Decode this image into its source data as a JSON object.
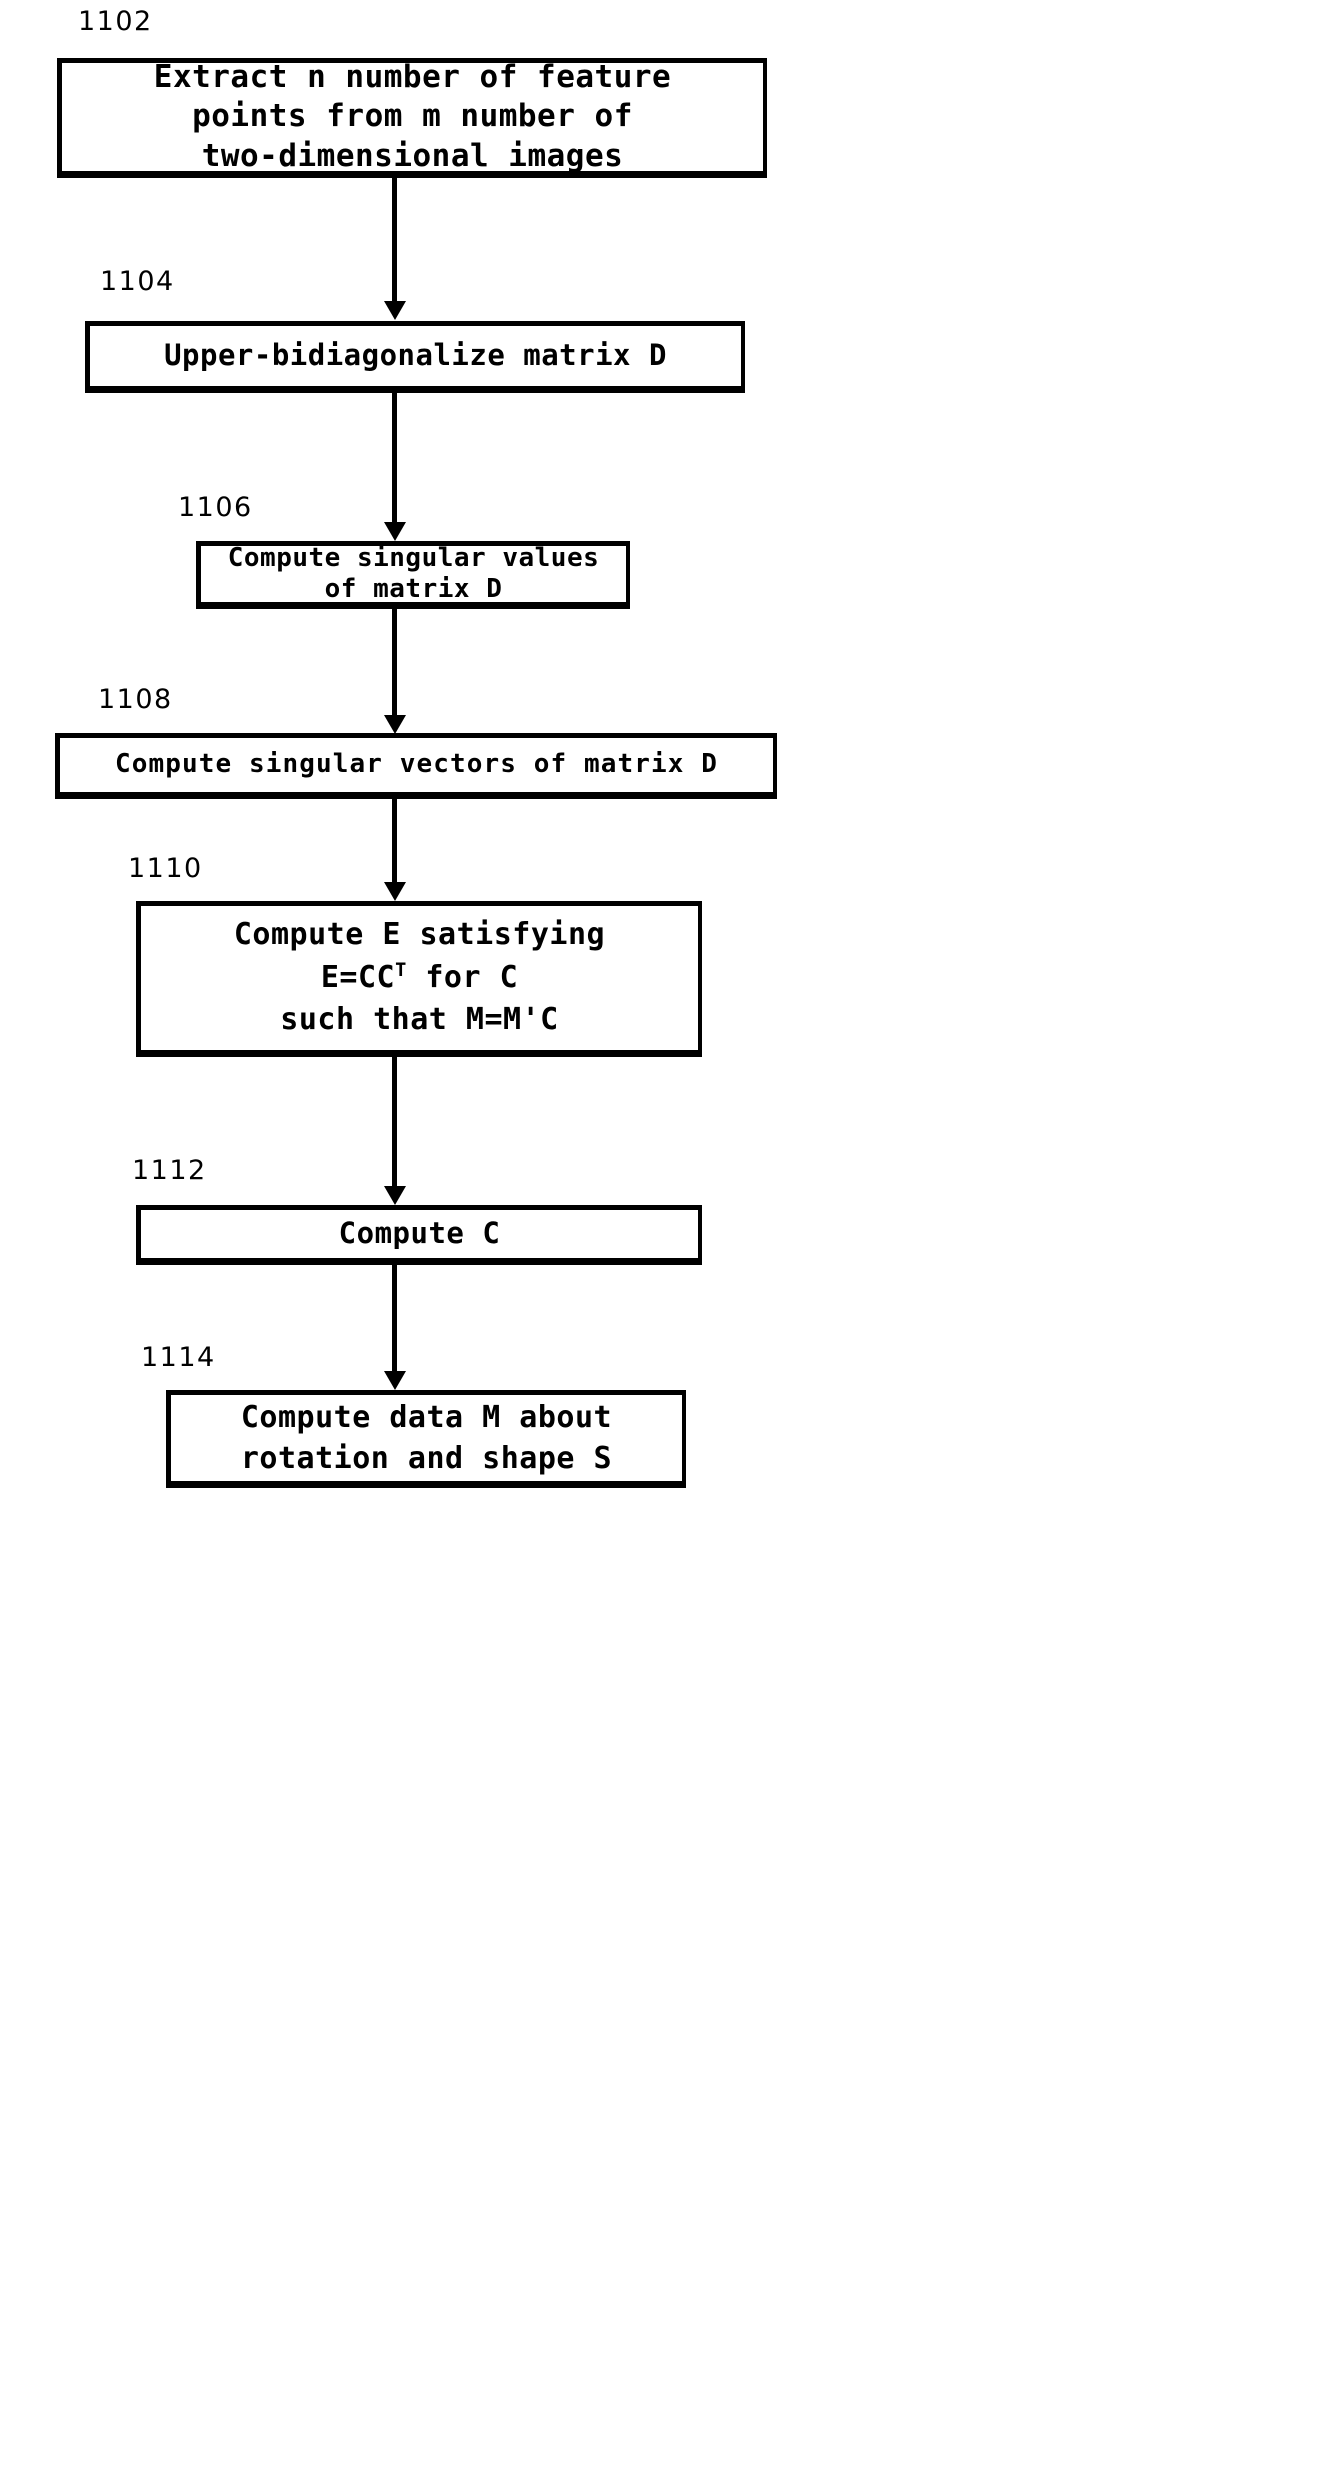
{
  "figure": {
    "type": "flowchart",
    "orientation": "vertical",
    "ink_color": "#000000",
    "background_color": "#ffffff"
  },
  "nodes": [
    {
      "ref": "1102",
      "text": "Extract n number of feature\npoints from m number of\ntwo-dimensional images"
    },
    {
      "ref": "1104",
      "text": "Upper-bidiagonalize matrix D"
    },
    {
      "ref": "1106",
      "text": "Compute singular values\nof matrix D"
    },
    {
      "ref": "1108",
      "text": "Compute singular vectors of matrix D"
    },
    {
      "ref": "1110",
      "text": "Compute E satisfying\nE=CCT for C\nsuch that M=M'C",
      "line1": "Compute E satisfying",
      "line2_base": "E=CC",
      "line2_sup": "T",
      "line2_tail": " for C",
      "line3": "such that M=M'C"
    },
    {
      "ref": "1112",
      "text": "Compute C"
    },
    {
      "ref": "1114",
      "text": "Compute data M about\nrotation and shape S"
    }
  ],
  "connectors": [
    {
      "from": "1102",
      "to": "1104",
      "style": "arrow-down"
    },
    {
      "from": "1104",
      "to": "1106",
      "style": "arrow-down"
    },
    {
      "from": "1106",
      "to": "1108",
      "style": "arrow-down"
    },
    {
      "from": "1108",
      "to": "1110",
      "style": "arrow-down"
    },
    {
      "from": "1110",
      "to": "1112",
      "style": "arrow-down"
    },
    {
      "from": "1112",
      "to": "1114",
      "style": "arrow-down"
    }
  ]
}
